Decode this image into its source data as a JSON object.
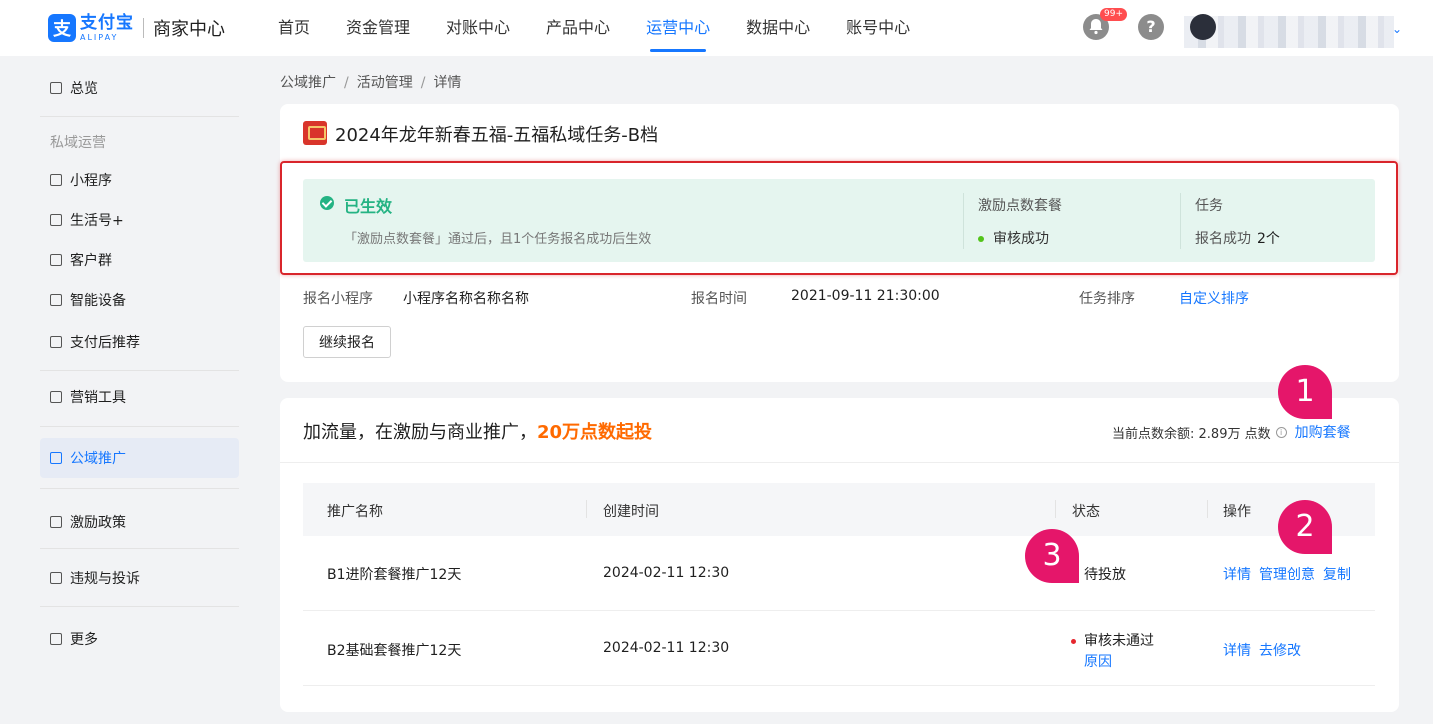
{
  "header": {
    "logo_cn": "支付宝",
    "logo_en": "ALIPAY",
    "logo_sub": "商家中心",
    "nav": [
      "首页",
      "资金管理",
      "对账中心",
      "产品中心",
      "运营中心",
      "数据中心",
      "账号中心"
    ],
    "active_nav": "运营中心",
    "notification_badge": "99+",
    "help_label": "?"
  },
  "sidebar": {
    "overview": "总览",
    "group_private": "私域运营",
    "mini_program": "小程序",
    "life_account": "生活号+",
    "customer_group": "客户群",
    "smart_device": "智能设备",
    "after_pay": "支付后推荐",
    "marketing_tools": "营销工具",
    "public_promo": "公域推广",
    "incentive_policy": "激励政策",
    "violation": "违规与投诉",
    "more": "更多"
  },
  "breadcrumb": [
    "公域推广",
    "活动管理",
    "详情"
  ],
  "activity": {
    "title": "2024年龙年新春五福-五福私域任务-B档",
    "status": "已生效",
    "status_desc": "「激励点数套餐」通过后，且1个任务报名成功后生效",
    "package_label": "激励点数套餐",
    "package_status": "审核成功",
    "task_label": "任务",
    "task_status": "报名成功",
    "task_count": "2个",
    "signup_mini_label": "报名小程序",
    "signup_mini_value": "小程序名称名称名称",
    "signup_time_label": "报名时间",
    "signup_time_value": "2021-09-11 21:30:00",
    "task_sort_label": "任务排序",
    "task_sort_link": "自定义排序",
    "continue_button": "继续报名"
  },
  "promotion": {
    "title_prefix": "加流量，在激励与商业推广，",
    "title_highlight": "20万点数起投",
    "balance_label": "当前点数余额:",
    "balance_value": "2.89万 点数",
    "buy_link": "加购套餐",
    "columns": [
      "推广名称",
      "创建时间",
      "状态",
      "操作"
    ],
    "rows": [
      {
        "name": "B1进阶套餐推广12天",
        "created": "2024-02-11 12:30",
        "status": "待投放",
        "status_link": "",
        "actions": [
          "详情",
          "管理创意",
          "复制"
        ]
      },
      {
        "name": "B2基础套餐推广12天",
        "created": "2024-02-11 12:30",
        "status": "审核未通过",
        "status_link": "原因",
        "actions": [
          "详情",
          "去修改"
        ]
      }
    ]
  },
  "annotations": [
    "1",
    "2",
    "3"
  ],
  "colors": {
    "brand": "#1677ff",
    "success": "#24b383",
    "highlight": "#ff6a00",
    "marker": "#e5166a",
    "alert_border": "#d9252b"
  }
}
